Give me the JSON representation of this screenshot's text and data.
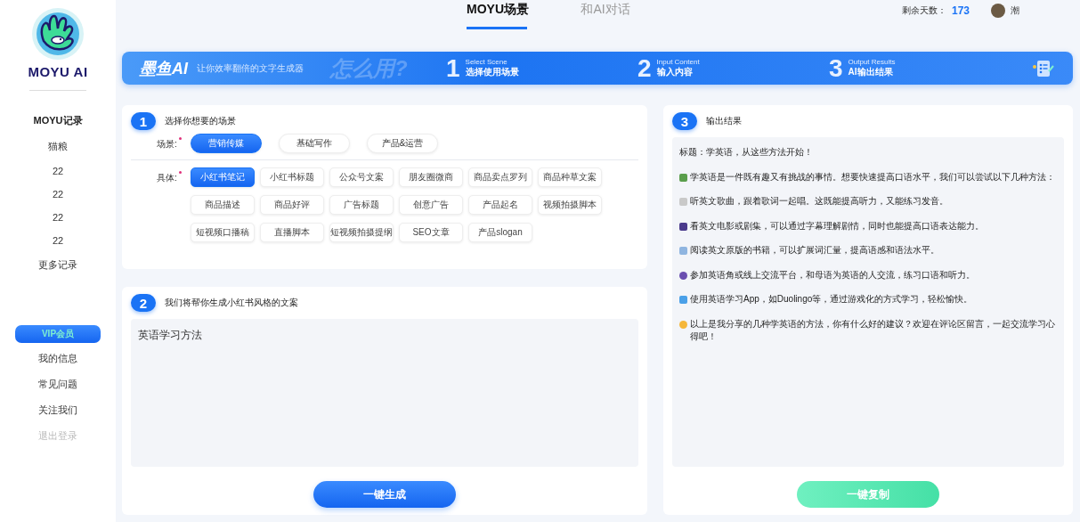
{
  "sidebar": {
    "logo_text": "MOYU AI",
    "history_title": "MOYU记录",
    "history": [
      "猫粮",
      "22",
      "22",
      "22",
      "22"
    ],
    "more": "更多记录",
    "vip": "VIP会员",
    "links": [
      {
        "label": "我的信息",
        "disabled": false
      },
      {
        "label": "常见问题",
        "disabled": false
      },
      {
        "label": "关注我们",
        "disabled": false
      },
      {
        "label": "退出登录",
        "disabled": true
      }
    ]
  },
  "header": {
    "tabs": [
      {
        "label": "MOYU场景",
        "selected": true
      },
      {
        "label": "和AI对话",
        "selected": false
      }
    ],
    "days_label": "剩余天数：",
    "days": "173",
    "user": "潮"
  },
  "banner": {
    "brand": "墨鱼AI",
    "slogan": "让你效率翻倍的文字生成器",
    "decor": "怎么用?",
    "steps": [
      {
        "number": "1",
        "subtitle": "Select Scene",
        "title": "选择使用场景"
      },
      {
        "number": "2",
        "subtitle": "Input Content",
        "title": "输入内容"
      },
      {
        "number": "3",
        "subtitle": "Output Results",
        "title": "AI输出结果"
      }
    ]
  },
  "scene": {
    "number": "1",
    "title": "选择你想要的场景",
    "category_label": "场景:",
    "category_required": true,
    "categories": [
      {
        "label": "营销传媒",
        "selected": true
      },
      {
        "label": "基础写作",
        "selected": false
      },
      {
        "label": "产品&运营",
        "selected": false
      }
    ],
    "detail_label": "具体:",
    "detail_required": true,
    "details": [
      {
        "label": "小红书笔记",
        "selected": true
      },
      {
        "label": "小红书标题",
        "selected": false
      },
      {
        "label": "公众号文案",
        "selected": false
      },
      {
        "label": "朋友圈微商",
        "selected": false
      },
      {
        "label": "商品卖点罗列",
        "selected": false
      },
      {
        "label": "商品种草文案",
        "selected": false
      },
      {
        "label": "商品描述",
        "selected": false
      },
      {
        "label": "商品好评",
        "selected": false
      },
      {
        "label": "广告标题",
        "selected": false
      },
      {
        "label": "创意广告",
        "selected": false
      },
      {
        "label": "产品起名",
        "selected": false
      },
      {
        "label": "视频拍摄脚本",
        "selected": false
      },
      {
        "label": "短视频口播稿",
        "selected": false
      },
      {
        "label": "直播脚本",
        "selected": false
      },
      {
        "label": "短视频拍摄提纲",
        "selected": false
      },
      {
        "label": "SEO文章",
        "selected": false
      },
      {
        "label": "产品slogan",
        "selected": false
      }
    ]
  },
  "input": {
    "number": "2",
    "title": "我们将帮你生成小红书风格的文案",
    "value": "英语学习方法",
    "button": "一键生成"
  },
  "output": {
    "number": "3",
    "title": "输出结果",
    "heading": "标题：学英语，从这些方法开始！",
    "lines": [
      "学英语是一件既有趣又有挑战的事情。想要快速提高口语水平，我们可以尝试以下几种方法：",
      "听英文歌曲，跟着歌词一起唱。这既能提高听力，又能练习发音。",
      "看英文电影或剧集，可以通过字幕理解剧情，同时也能提高口语表达能力。",
      "阅读英文原版的书籍，可以扩展词汇量，提高语感和语法水平。",
      "参加英语角或线上交流平台，和母语为英语的人交流，练习口语和听力。",
      "使用英语学习App，如Duolingo等，通过游戏化的方式学习，轻松愉快。",
      "以上是我分享的几种学英语的方法，你有什么好的建议？欢迎在评论区留言，一起交流学习心得吧！"
    ],
    "button": "一键复制"
  }
}
